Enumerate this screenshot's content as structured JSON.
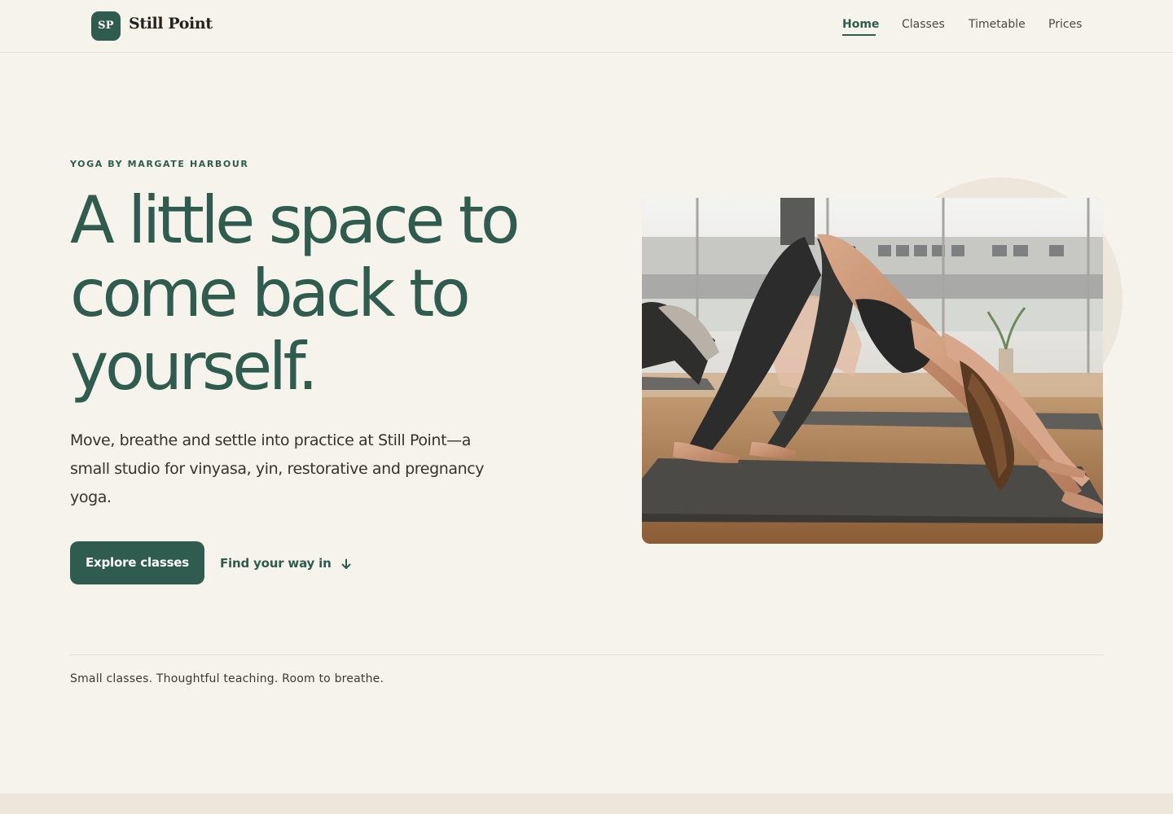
{
  "brand": {
    "mark": "SP",
    "name": "Still Point"
  },
  "nav": {
    "items": [
      {
        "label": "Home",
        "active": true
      },
      {
        "label": "Classes",
        "active": false
      },
      {
        "label": "Timetable",
        "active": false
      },
      {
        "label": "Prices",
        "active": false
      }
    ]
  },
  "hero": {
    "eyebrow": "YOGA BY MARGATE HARBOUR",
    "title": "A little space to come back to yourself.",
    "body": "Move, breathe and settle into practice at Still Point—a small studio for vinyasa, yin, restorative and pregnancy yoga.",
    "primary_cta": "Explore classes",
    "secondary_cta": "Find your way in",
    "secondary_icon": "arrow-down-icon"
  },
  "tagline": "Small classes. Thoughtful teaching. Room to breathe.",
  "colors": {
    "background": "#f6f3ed",
    "accent": "#2f5c4f",
    "accent_soft": "#ede6da",
    "text": "#34342f"
  }
}
